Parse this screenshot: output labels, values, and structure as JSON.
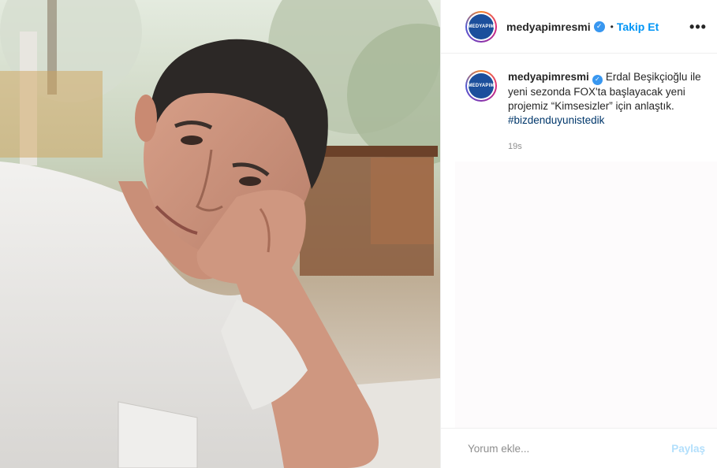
{
  "post": {
    "image_alt": "Erdal Beşikçioğlu resting his head on his hand",
    "header": {
      "avatar_text": "MEDYAPIM",
      "username": "medyapimresmi",
      "verified_icon": "verified-badge-icon",
      "bullet": "•",
      "follow_label": "Takip Et",
      "more_label": "•••"
    },
    "caption": {
      "avatar_text": "MEDYAPIM",
      "username": "medyapimresmi",
      "text": "Erdal Beşikçioğlu ile yeni sezonda FOX'ta başlayacak yeni projemiz “Kimsesizler” için anlaştık.",
      "hashtag": "#bizdenduyunistedik",
      "time": "19s"
    },
    "comment_input": {
      "placeholder": "Yorum ekle...",
      "share_label": "Paylaş"
    }
  },
  "colors": {
    "accent": "#0095f6",
    "share_disabled": "#b2dffc",
    "verified": "#3897f0",
    "avatar_brand": "#1c4f9c"
  }
}
